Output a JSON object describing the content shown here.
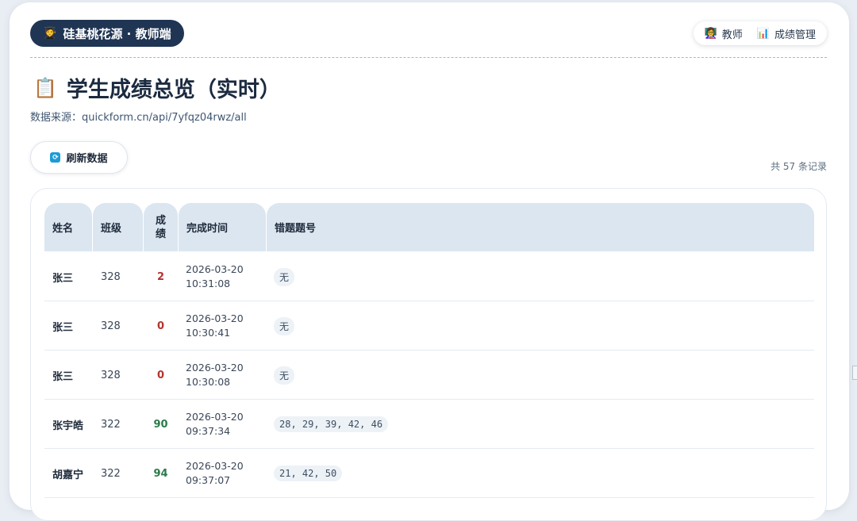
{
  "header": {
    "brand_icon": "graduate-icon",
    "brand_title": "硅基桃花源 · 教师端",
    "nav": [
      {
        "icon": "teacher-icon",
        "label": "教师"
      },
      {
        "icon": "bar-chart-icon",
        "label": "成绩管理"
      }
    ]
  },
  "page": {
    "title": "学生成绩总览（实时）",
    "title_icon": "clipboard-icon",
    "source": "数据来源：quickform.cn/api/7yfqz04rwz/all"
  },
  "toolbar": {
    "refresh_label": "刷新数据",
    "record_count": "共 57 条记录"
  },
  "table": {
    "columns": [
      "姓名",
      "班级",
      "成\n绩",
      "完成时间",
      "错题题号"
    ],
    "rows": [
      {
        "name": "张三",
        "class": "328",
        "score": "2",
        "score_level": "low",
        "date": "2026-03-20",
        "time": "10:31:08",
        "wrong": "无"
      },
      {
        "name": "张三",
        "class": "328",
        "score": "0",
        "score_level": "low",
        "date": "2026-03-20",
        "time": "10:30:41",
        "wrong": "无"
      },
      {
        "name": "张三",
        "class": "328",
        "score": "0",
        "score_level": "low",
        "date": "2026-03-20",
        "time": "10:30:08",
        "wrong": "无"
      },
      {
        "name": "张宇皓",
        "class": "322",
        "score": "90",
        "score_level": "high",
        "date": "2026-03-20",
        "time": "09:37:34",
        "wrong": "28, 29, 39, 42, 46"
      },
      {
        "name": "胡嘉宁",
        "class": "322",
        "score": "94",
        "score_level": "high",
        "date": "2026-03-20",
        "time": "09:37:07",
        "wrong": "21, 42, 50"
      }
    ]
  },
  "colors": {
    "brand_bg": "#1f3553",
    "header_cell_bg": "#dbe6f0",
    "score_low": "#b3342e",
    "score_high": "#2a7a4a"
  }
}
